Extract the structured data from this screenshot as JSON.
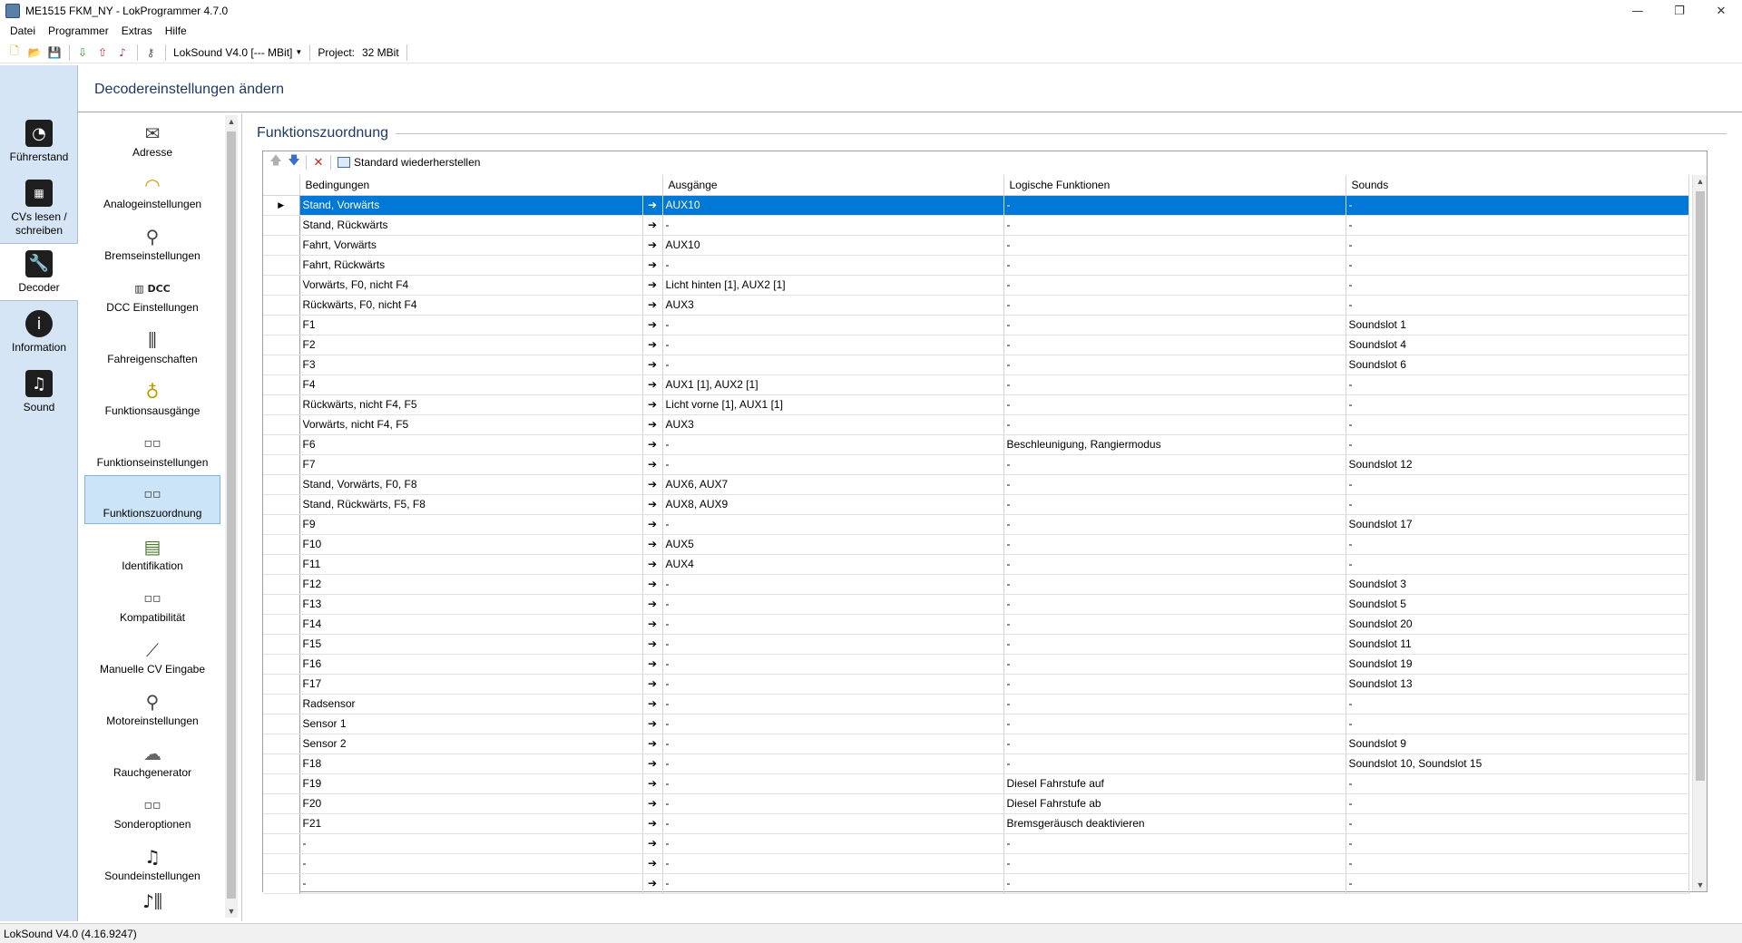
{
  "window": {
    "title": "ME1515 FKM_NY - LokProgrammer 4.7.0",
    "controls": [
      "—",
      "❐",
      "✕"
    ]
  },
  "menu": [
    "Datei",
    "Programmer",
    "Extras",
    "Hilfe"
  ],
  "toolbar": {
    "decoder_combo": "LokSound V4.0 [--- MBit]",
    "project_label": "Project:",
    "project_size": "32 MBit"
  },
  "leftnav": [
    {
      "label": "Führerstand",
      "icon": "speedometer-icon"
    },
    {
      "label": "CVs lesen / schreiben",
      "icon": "chip-icon"
    },
    {
      "label": "Decoder",
      "icon": "wrench-icon",
      "selected": true
    },
    {
      "label": "Information",
      "icon": "info-icon"
    },
    {
      "label": "Sound",
      "icon": "music-note-icon"
    }
  ],
  "header": {
    "title": "Decodereinstellungen ändern"
  },
  "subnav": [
    {
      "label": "Adresse",
      "icon": "envelope-icon"
    },
    {
      "label": "Analogeinstellungen",
      "icon": "gauge-icon"
    },
    {
      "label": "Bremseinstellungen",
      "icon": "brake-lever-icon"
    },
    {
      "label": "DCC Einstellungen",
      "icon": "dcc-icon"
    },
    {
      "label": "Fahreigenschaften",
      "icon": "sliders-icon"
    },
    {
      "label": "Funktionsausgänge",
      "icon": "lightbulb-icon"
    },
    {
      "label": "Funktionseinstellungen",
      "icon": "function-keys-icon"
    },
    {
      "label": "Funktionszuordnung",
      "icon": "function-keys-icon",
      "selected": true
    },
    {
      "label": "Identifikation",
      "icon": "id-card-icon"
    },
    {
      "label": "Kompatibilität",
      "icon": "function-keys-icon"
    },
    {
      "label": "Manuelle CV Eingabe",
      "icon": "screwdriver-icon"
    },
    {
      "label": "Motoreinstellungen",
      "icon": "motor-lever-icon"
    },
    {
      "label": "Rauchgenerator",
      "icon": "smoke-icon"
    },
    {
      "label": "Sonderoptionen",
      "icon": "function-keys-icon"
    },
    {
      "label": "Soundeinstellungen",
      "icon": "sound-notes-icon"
    },
    {
      "label": "",
      "icon": "mixer-icon"
    }
  ],
  "section": {
    "title": "Funktionszuordnung",
    "restore_label": "Standard wiederherstellen"
  },
  "grid": {
    "columns": [
      "Bedingungen",
      "Ausgänge",
      "Logische Funktionen",
      "Sounds"
    ],
    "rows": [
      [
        "Stand, Vorwärts",
        "AUX10",
        "-",
        "-"
      ],
      [
        "Stand, Rückwärts",
        "-",
        "-",
        "-"
      ],
      [
        "Fahrt, Vorwärts",
        "AUX10",
        "-",
        "-"
      ],
      [
        "Fahrt, Rückwärts",
        "-",
        "-",
        "-"
      ],
      [
        "Vorwärts, F0, nicht F4",
        "Licht hinten [1], AUX2 [1]",
        "-",
        "-"
      ],
      [
        "Rückwärts, F0, nicht F4",
        "AUX3",
        "-",
        "-"
      ],
      [
        "F1",
        "-",
        "-",
        "Soundslot 1"
      ],
      [
        "F2",
        "-",
        "-",
        "Soundslot 4"
      ],
      [
        "F3",
        "-",
        "-",
        "Soundslot 6"
      ],
      [
        "F4",
        "AUX1 [1], AUX2 [1]",
        "-",
        "-"
      ],
      [
        "Rückwärts, nicht F4, F5",
        "Licht vorne [1], AUX1 [1]",
        "-",
        "-"
      ],
      [
        "Vorwärts, nicht F4, F5",
        "AUX3",
        "-",
        "-"
      ],
      [
        "F6",
        "-",
        "Beschleunigung, Rangiermodus",
        "-"
      ],
      [
        "F7",
        "-",
        "-",
        "Soundslot 12"
      ],
      [
        "Stand, Vorwärts, F0, F8",
        "AUX6, AUX7",
        "-",
        "-"
      ],
      [
        "Stand, Rückwärts, F5, F8",
        "AUX8, AUX9",
        "-",
        "-"
      ],
      [
        "F9",
        "-",
        "-",
        "Soundslot 17"
      ],
      [
        "F10",
        "AUX5",
        "-",
        "-"
      ],
      [
        "F11",
        "AUX4",
        "-",
        "-"
      ],
      [
        "F12",
        "-",
        "-",
        "Soundslot 3"
      ],
      [
        "F13",
        "-",
        "-",
        "Soundslot 5"
      ],
      [
        "F14",
        "-",
        "-",
        "Soundslot 20"
      ],
      [
        "F15",
        "-",
        "-",
        "Soundslot 11"
      ],
      [
        "F16",
        "-",
        "-",
        "Soundslot 19"
      ],
      [
        "F17",
        "-",
        "-",
        "Soundslot 13"
      ],
      [
        "Radsensor",
        "-",
        "-",
        "-"
      ],
      [
        "Sensor 1",
        "-",
        "-",
        "-"
      ],
      [
        "Sensor 2",
        "-",
        "-",
        "Soundslot 9"
      ],
      [
        "F18",
        "-",
        "-",
        "Soundslot 10, Soundslot 15"
      ],
      [
        "F19",
        "-",
        "Diesel Fahrstufe auf",
        "-"
      ],
      [
        "F20",
        "-",
        "Diesel Fahrstufe ab",
        "-"
      ],
      [
        "F21",
        "-",
        "Bremsgeräusch deaktivieren",
        "-"
      ],
      [
        "-",
        "-",
        "-",
        "-"
      ],
      [
        "-",
        "-",
        "-",
        "-"
      ],
      [
        "-",
        "-",
        "-",
        "-"
      ]
    ],
    "selected_row": 0
  },
  "status": {
    "text": "LokSound V4.0 (4.16.9247)"
  },
  "colors": {
    "selection": "#0078d7",
    "nav_bg": "#d6e5f5",
    "heading": "#1f3864"
  }
}
